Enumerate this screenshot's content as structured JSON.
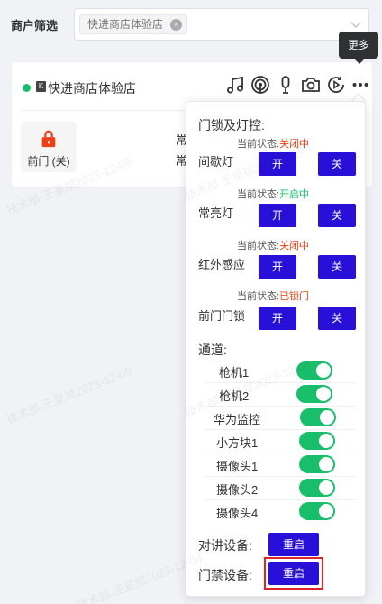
{
  "filter": {
    "label": "商户筛选",
    "selected_tag": "快进商店体验店",
    "tag_close_glyph": "×"
  },
  "store": {
    "name": "快进商店体验店",
    "k_badge": "K",
    "status_color": "#19be6b",
    "icons": [
      "music-icon",
      "broadcast-icon",
      "microphone-icon",
      "camera-icon",
      "playback-icon",
      "more-icon"
    ],
    "door_label": "前门 (关)",
    "partial_text_1": "常",
    "partial_text_2": "常"
  },
  "tooltip": {
    "text": "更多"
  },
  "popover": {
    "lock_section_title": "门锁及灯控:",
    "state_prefix": "当前状态:",
    "controls": [
      {
        "name": "间歇灯",
        "state": "关闭中",
        "state_kind": "closed",
        "on_label": "开",
        "off_label": "关"
      },
      {
        "name": "常亮灯",
        "state": "开启中",
        "state_kind": "open",
        "on_label": "开",
        "off_label": "关"
      },
      {
        "name": "红外感应",
        "state": "关闭中",
        "state_kind": "closed",
        "on_label": "开",
        "off_label": "关"
      },
      {
        "name": "前门门锁",
        "state": "已锁门",
        "state_kind": "closed",
        "on_label": "开",
        "off_label": "关"
      }
    ],
    "channel_section_title": "通道:",
    "channels": [
      {
        "name": "枪机1",
        "enabled": true
      },
      {
        "name": "枪机2",
        "enabled": true
      },
      {
        "name": "华为监控",
        "enabled": true
      },
      {
        "name": "小方块1",
        "enabled": true
      },
      {
        "name": "摄像头1",
        "enabled": true
      },
      {
        "name": "摄像头2",
        "enabled": true
      },
      {
        "name": "摄像头4",
        "enabled": true
      }
    ],
    "intercom": {
      "label": "对讲设备:",
      "button": "重启"
    },
    "access": {
      "label": "门禁设备:",
      "button": "重启"
    }
  },
  "colors": {
    "accent_button": "#2910d8",
    "switch_on": "#19be6b",
    "state_closed": "#ed4014",
    "state_open": "#19be6b",
    "highlight_border": "#d9262a"
  },
  "watermark_text": "技术部-王星斌2023-12-08"
}
